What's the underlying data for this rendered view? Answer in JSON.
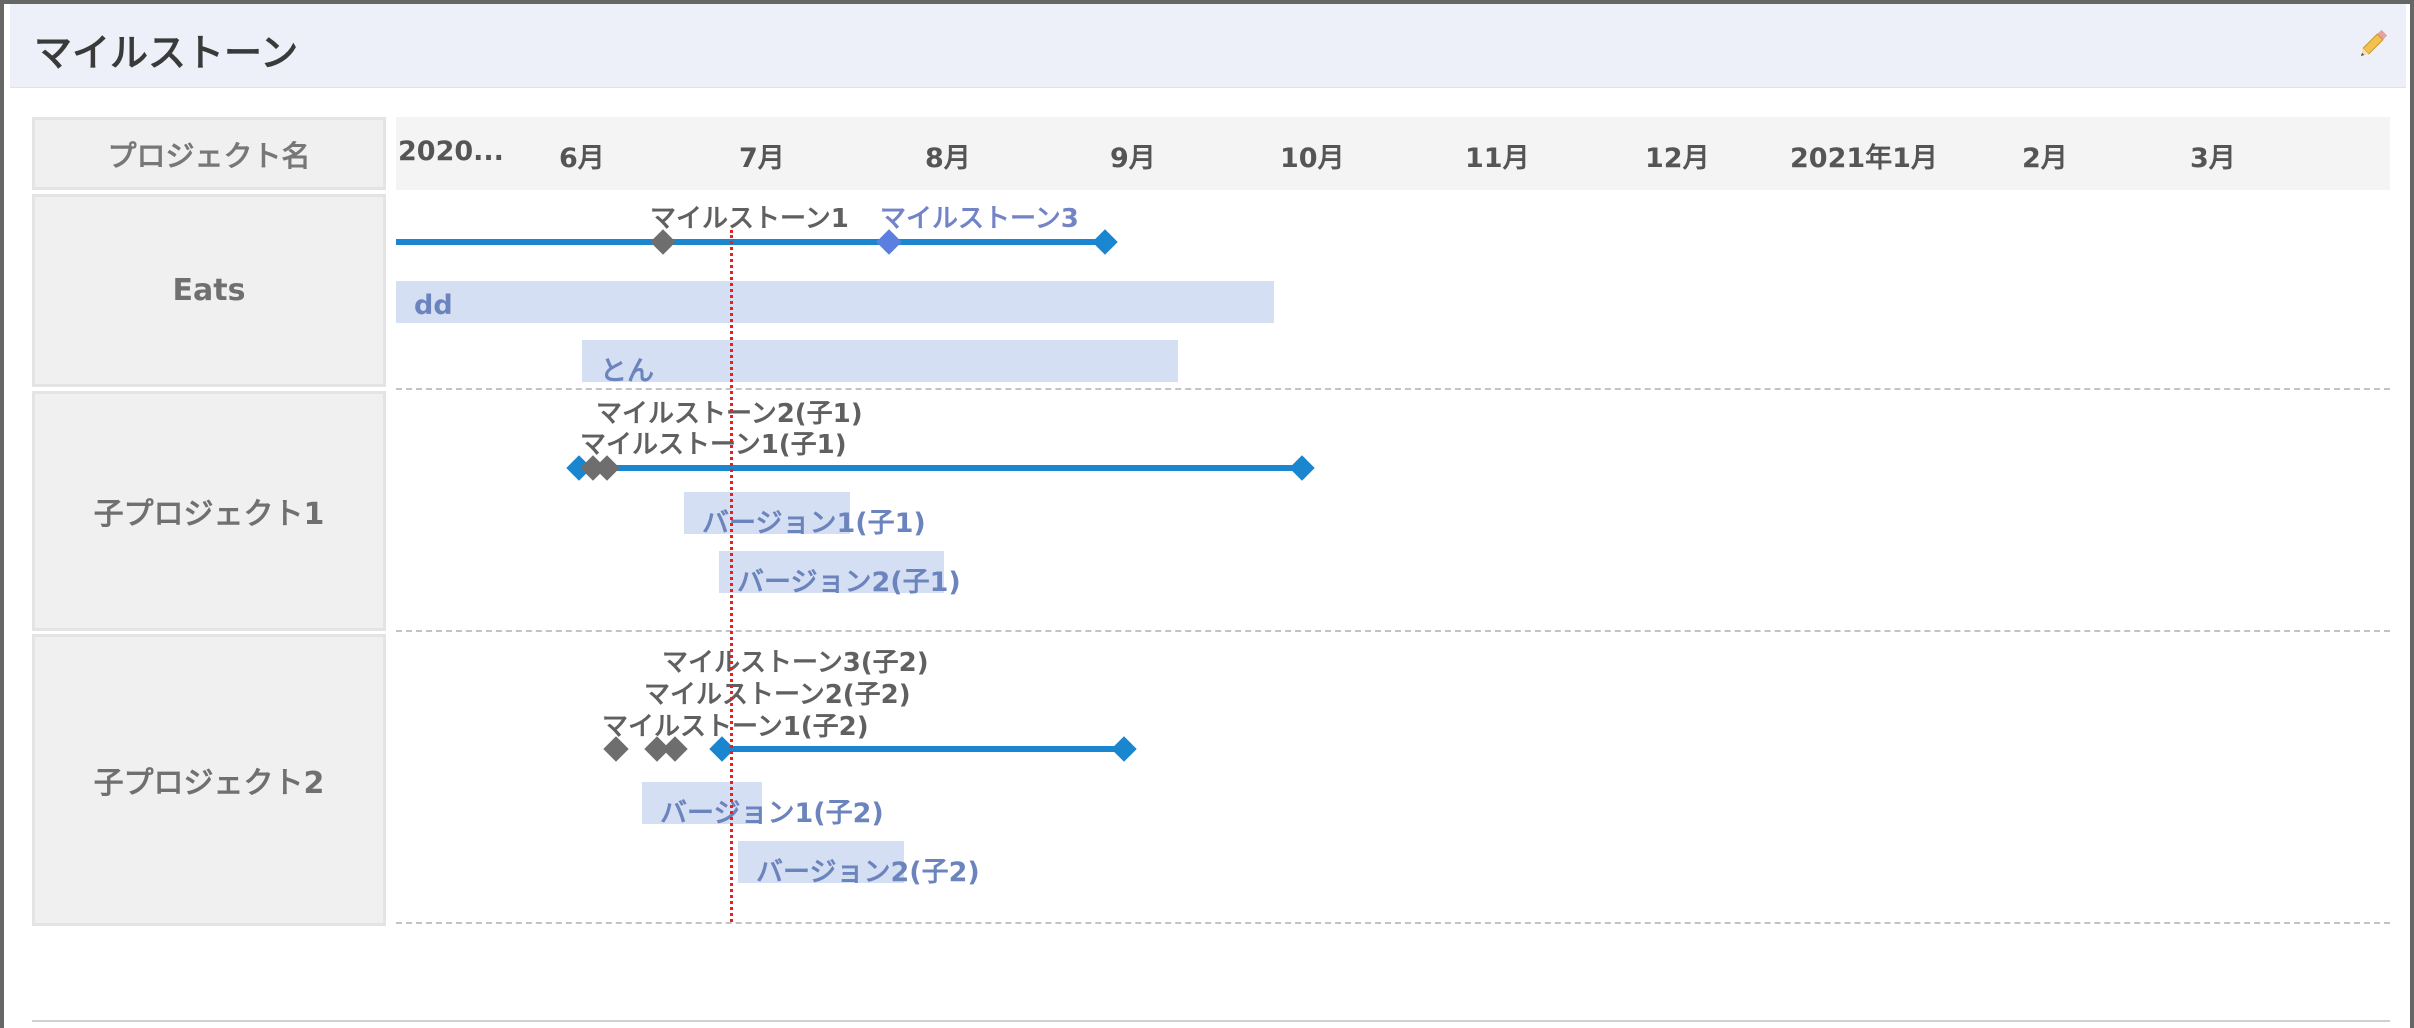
{
  "header": {
    "title": "マイルストーン",
    "edit_icon": "pencil-icon"
  },
  "table": {
    "name_header": "プロジェクト名"
  },
  "months": [
    "2020...",
    "6月",
    "7月",
    "8月",
    "9月",
    "10月",
    "11月",
    "12月",
    "2021年1月",
    "2月",
    "3月"
  ],
  "projects": [
    {
      "name": "Eats",
      "milestones": [
        "マイルストーン1",
        "マイルストーン3"
      ],
      "versions": [
        "dd",
        "とん"
      ]
    },
    {
      "name": "子プロジェクト1",
      "milestones": [
        "マイルストーン2(子1)",
        "マイルストーン1(子1)"
      ],
      "versions": [
        "バージョン1(子1)",
        "バージョン2(子1)"
      ]
    },
    {
      "name": "子プロジェクト2",
      "milestones": [
        "マイルストーン3(子2)",
        "マイルストーン2(子2)",
        "マイルストーン1(子2)"
      ],
      "versions": [
        "バージョン1(子2)",
        "バージョン2(子2)"
      ]
    }
  ],
  "colors": {
    "timeline": "#1a86d0",
    "version_bar": "#d5dff3",
    "version_text": "#6c84bd",
    "today_line": "#e02424"
  }
}
